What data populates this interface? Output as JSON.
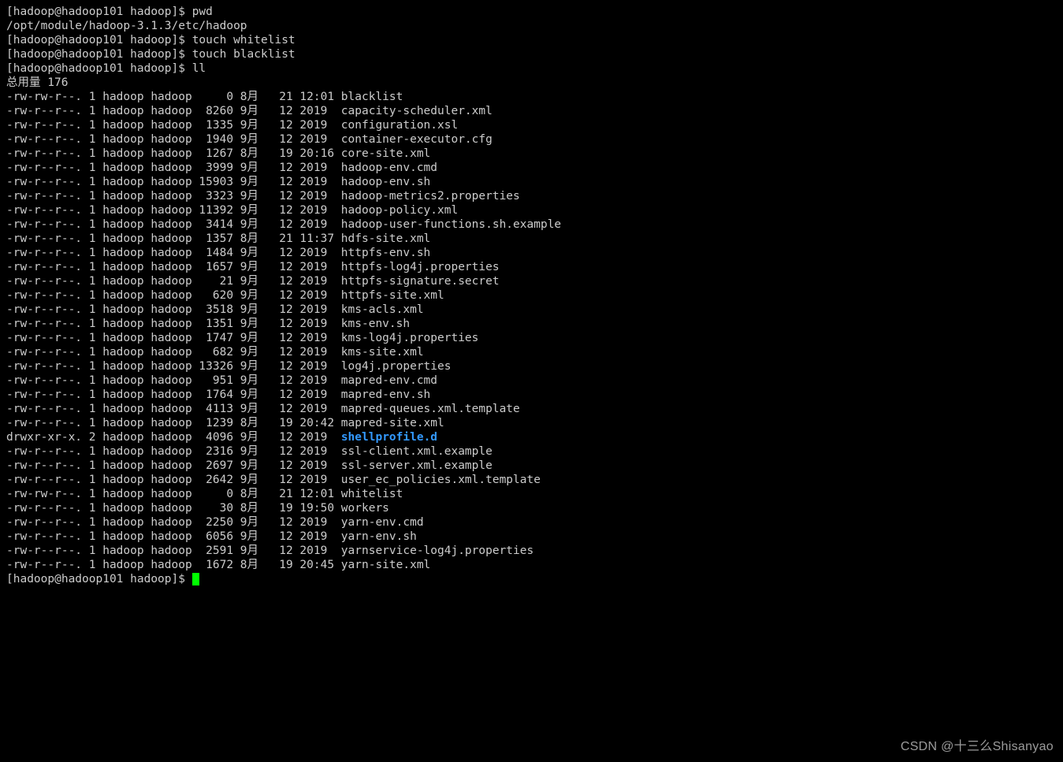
{
  "prompt": "[hadoop@hadoop101 hadoop]$ ",
  "cmd_pwd": "pwd",
  "pwd_out": "/opt/module/hadoop-3.1.3/etc/hadoop",
  "cmd_touch_w": "touch whitelist",
  "cmd_touch_b": "touch blacklist",
  "cmd_ll": "ll",
  "total": "总用量 176",
  "dir_name": "shellprofile.d",
  "watermark": "CSDN @十三么Shisanyao",
  "rows": [
    {
      "perm": "-rw-rw-r--.",
      "n": "1",
      "u": "hadoop",
      "g": "hadoop",
      "size": "0",
      "m": "8月",
      "d": "21",
      "t": "12:01",
      "name": "blacklist"
    },
    {
      "perm": "-rw-r--r--.",
      "n": "1",
      "u": "hadoop",
      "g": "hadoop",
      "size": "8260",
      "m": "9月",
      "d": "12",
      "t": "2019",
      "name": "capacity-scheduler.xml"
    },
    {
      "perm": "-rw-r--r--.",
      "n": "1",
      "u": "hadoop",
      "g": "hadoop",
      "size": "1335",
      "m": "9月",
      "d": "12",
      "t": "2019",
      "name": "configuration.xsl"
    },
    {
      "perm": "-rw-r--r--.",
      "n": "1",
      "u": "hadoop",
      "g": "hadoop",
      "size": "1940",
      "m": "9月",
      "d": "12",
      "t": "2019",
      "name": "container-executor.cfg"
    },
    {
      "perm": "-rw-r--r--.",
      "n": "1",
      "u": "hadoop",
      "g": "hadoop",
      "size": "1267",
      "m": "8月",
      "d": "19",
      "t": "20:16",
      "name": "core-site.xml"
    },
    {
      "perm": "-rw-r--r--.",
      "n": "1",
      "u": "hadoop",
      "g": "hadoop",
      "size": "3999",
      "m": "9月",
      "d": "12",
      "t": "2019",
      "name": "hadoop-env.cmd"
    },
    {
      "perm": "-rw-r--r--.",
      "n": "1",
      "u": "hadoop",
      "g": "hadoop",
      "size": "15903",
      "m": "9月",
      "d": "12",
      "t": "2019",
      "name": "hadoop-env.sh"
    },
    {
      "perm": "-rw-r--r--.",
      "n": "1",
      "u": "hadoop",
      "g": "hadoop",
      "size": "3323",
      "m": "9月",
      "d": "12",
      "t": "2019",
      "name": "hadoop-metrics2.properties"
    },
    {
      "perm": "-rw-r--r--.",
      "n": "1",
      "u": "hadoop",
      "g": "hadoop",
      "size": "11392",
      "m": "9月",
      "d": "12",
      "t": "2019",
      "name": "hadoop-policy.xml"
    },
    {
      "perm": "-rw-r--r--.",
      "n": "1",
      "u": "hadoop",
      "g": "hadoop",
      "size": "3414",
      "m": "9月",
      "d": "12",
      "t": "2019",
      "name": "hadoop-user-functions.sh.example"
    },
    {
      "perm": "-rw-r--r--.",
      "n": "1",
      "u": "hadoop",
      "g": "hadoop",
      "size": "1357",
      "m": "8月",
      "d": "21",
      "t": "11:37",
      "name": "hdfs-site.xml"
    },
    {
      "perm": "-rw-r--r--.",
      "n": "1",
      "u": "hadoop",
      "g": "hadoop",
      "size": "1484",
      "m": "9月",
      "d": "12",
      "t": "2019",
      "name": "httpfs-env.sh"
    },
    {
      "perm": "-rw-r--r--.",
      "n": "1",
      "u": "hadoop",
      "g": "hadoop",
      "size": "1657",
      "m": "9月",
      "d": "12",
      "t": "2019",
      "name": "httpfs-log4j.properties"
    },
    {
      "perm": "-rw-r--r--.",
      "n": "1",
      "u": "hadoop",
      "g": "hadoop",
      "size": "21",
      "m": "9月",
      "d": "12",
      "t": "2019",
      "name": "httpfs-signature.secret"
    },
    {
      "perm": "-rw-r--r--.",
      "n": "1",
      "u": "hadoop",
      "g": "hadoop",
      "size": "620",
      "m": "9月",
      "d": "12",
      "t": "2019",
      "name": "httpfs-site.xml"
    },
    {
      "perm": "-rw-r--r--.",
      "n": "1",
      "u": "hadoop",
      "g": "hadoop",
      "size": "3518",
      "m": "9月",
      "d": "12",
      "t": "2019",
      "name": "kms-acls.xml"
    },
    {
      "perm": "-rw-r--r--.",
      "n": "1",
      "u": "hadoop",
      "g": "hadoop",
      "size": "1351",
      "m": "9月",
      "d": "12",
      "t": "2019",
      "name": "kms-env.sh"
    },
    {
      "perm": "-rw-r--r--.",
      "n": "1",
      "u": "hadoop",
      "g": "hadoop",
      "size": "1747",
      "m": "9月",
      "d": "12",
      "t": "2019",
      "name": "kms-log4j.properties"
    },
    {
      "perm": "-rw-r--r--.",
      "n": "1",
      "u": "hadoop",
      "g": "hadoop",
      "size": "682",
      "m": "9月",
      "d": "12",
      "t": "2019",
      "name": "kms-site.xml"
    },
    {
      "perm": "-rw-r--r--.",
      "n": "1",
      "u": "hadoop",
      "g": "hadoop",
      "size": "13326",
      "m": "9月",
      "d": "12",
      "t": "2019",
      "name": "log4j.properties"
    },
    {
      "perm": "-rw-r--r--.",
      "n": "1",
      "u": "hadoop",
      "g": "hadoop",
      "size": "951",
      "m": "9月",
      "d": "12",
      "t": "2019",
      "name": "mapred-env.cmd"
    },
    {
      "perm": "-rw-r--r--.",
      "n": "1",
      "u": "hadoop",
      "g": "hadoop",
      "size": "1764",
      "m": "9月",
      "d": "12",
      "t": "2019",
      "name": "mapred-env.sh"
    },
    {
      "perm": "-rw-r--r--.",
      "n": "1",
      "u": "hadoop",
      "g": "hadoop",
      "size": "4113",
      "m": "9月",
      "d": "12",
      "t": "2019",
      "name": "mapred-queues.xml.template"
    },
    {
      "perm": "-rw-r--r--.",
      "n": "1",
      "u": "hadoop",
      "g": "hadoop",
      "size": "1239",
      "m": "8月",
      "d": "19",
      "t": "20:42",
      "name": "mapred-site.xml"
    },
    {
      "perm": "drwxr-xr-x.",
      "n": "2",
      "u": "hadoop",
      "g": "hadoop",
      "size": "4096",
      "m": "9月",
      "d": "12",
      "t": "2019",
      "name": "shellprofile.d",
      "dir": true
    },
    {
      "perm": "-rw-r--r--.",
      "n": "1",
      "u": "hadoop",
      "g": "hadoop",
      "size": "2316",
      "m": "9月",
      "d": "12",
      "t": "2019",
      "name": "ssl-client.xml.example"
    },
    {
      "perm": "-rw-r--r--.",
      "n": "1",
      "u": "hadoop",
      "g": "hadoop",
      "size": "2697",
      "m": "9月",
      "d": "12",
      "t": "2019",
      "name": "ssl-server.xml.example"
    },
    {
      "perm": "-rw-r--r--.",
      "n": "1",
      "u": "hadoop",
      "g": "hadoop",
      "size": "2642",
      "m": "9月",
      "d": "12",
      "t": "2019",
      "name": "user_ec_policies.xml.template"
    },
    {
      "perm": "-rw-rw-r--.",
      "n": "1",
      "u": "hadoop",
      "g": "hadoop",
      "size": "0",
      "m": "8月",
      "d": "21",
      "t": "12:01",
      "name": "whitelist"
    },
    {
      "perm": "-rw-r--r--.",
      "n": "1",
      "u": "hadoop",
      "g": "hadoop",
      "size": "30",
      "m": "8月",
      "d": "19",
      "t": "19:50",
      "name": "workers"
    },
    {
      "perm": "-rw-r--r--.",
      "n": "1",
      "u": "hadoop",
      "g": "hadoop",
      "size": "2250",
      "m": "9月",
      "d": "12",
      "t": "2019",
      "name": "yarn-env.cmd"
    },
    {
      "perm": "-rw-r--r--.",
      "n": "1",
      "u": "hadoop",
      "g": "hadoop",
      "size": "6056",
      "m": "9月",
      "d": "12",
      "t": "2019",
      "name": "yarn-env.sh"
    },
    {
      "perm": "-rw-r--r--.",
      "n": "1",
      "u": "hadoop",
      "g": "hadoop",
      "size": "2591",
      "m": "9月",
      "d": "12",
      "t": "2019",
      "name": "yarnservice-log4j.properties"
    },
    {
      "perm": "-rw-r--r--.",
      "n": "1",
      "u": "hadoop",
      "g": "hadoop",
      "size": "1672",
      "m": "8月",
      "d": "19",
      "t": "20:45",
      "name": "yarn-site.xml"
    }
  ]
}
